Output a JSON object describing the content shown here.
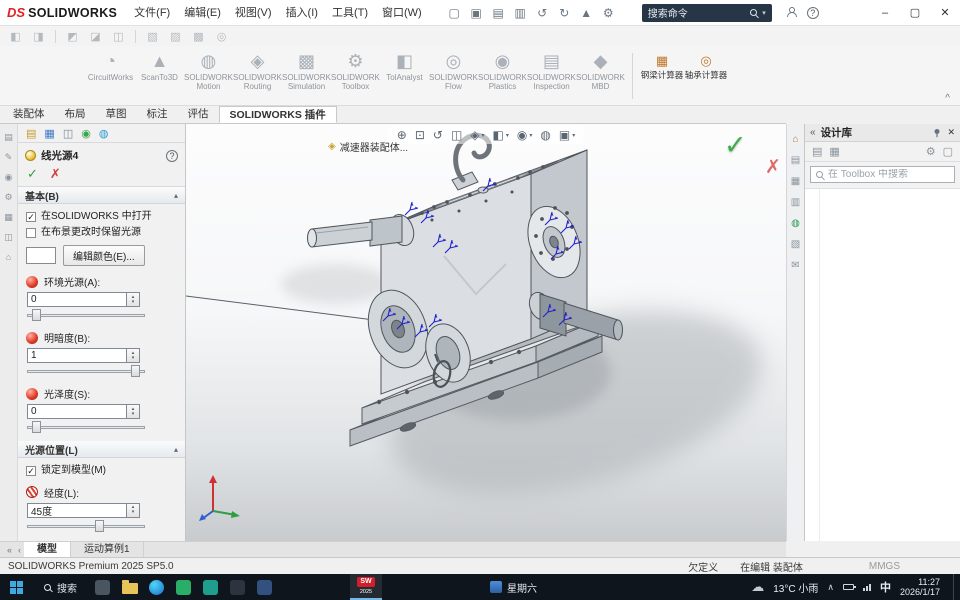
{
  "colors": {
    "logo_red": "#e12026",
    "mate_blue": "#2222cc",
    "confirm_green": "#3fae49",
    "cancel_red": "#df6a6a",
    "taskbar_bg": "#0f151d",
    "command_search_bg": "#273646",
    "taskbar_accent": "#76b9e8"
  },
  "icons": {
    "check": "✓",
    "cross": "✗",
    "help": "?",
    "caret_down": "▾",
    "collapse_up": "▴",
    "spin_up": "▴",
    "spin_down": "▾",
    "minimize": "–",
    "maximize": "▢",
    "close": "✕",
    "chevrons_left": "«",
    "tab_prev": "«",
    "tab_prev2": "‹",
    "ribbon_collapse": "^",
    "tray_expand": "∧",
    "cloud": "☁",
    "assembly": "◈",
    "titlebar": [
      "▢",
      "▣",
      "▤",
      "▥",
      "↺",
      "↻",
      "▲",
      "⚙"
    ],
    "qat": [
      "◧",
      "◨",
      "◩",
      "◪",
      "◫",
      "▧",
      "▨",
      "▩",
      "◎"
    ],
    "left_strip": [
      "▤",
      "✎",
      "◉",
      "⚙",
      "▦",
      "◫",
      "⌂"
    ],
    "pm_tabs": [
      "▤",
      "▦",
      "◫",
      "◉",
      "◍"
    ],
    "headsup": [
      "⊕",
      "⊡",
      "↺",
      "◫",
      "◈",
      "◧",
      "◉",
      "◍",
      "▣"
    ],
    "right_strip": [
      "⌂",
      "▤",
      "▦",
      "▥",
      "◍",
      "▧",
      "✉"
    ],
    "taskpane_toolbar": [
      "▤",
      "▦",
      "⚙",
      "▢"
    ],
    "addins": [
      "◔",
      "▲",
      "◍",
      "◈",
      "▩",
      "⚙",
      "◧",
      "◎",
      "◉",
      "▤",
      "◆"
    ],
    "calculators": [
      "▦",
      "◎"
    ]
  },
  "title_bar": {
    "logo_mark": "DS",
    "logo_text": "SOLIDWORKS",
    "menus": [
      "文件(F)",
      "编辑(E)",
      "视图(V)",
      "插入(I)",
      "工具(T)",
      "窗口(W)"
    ],
    "search_placeholder": "搜索命令"
  },
  "ribbon": {
    "addins": [
      "CircuitWorks",
      "ScanTo3D",
      "SOLIDWORKS Motion",
      "SOLIDWORKS Routing",
      "SOLIDWORKS Simulation",
      "SOLIDWORKS Toolbox",
      "TolAnalyst",
      "SOLIDWORKS Flow Simulation",
      "SOLIDWORKS Plastics",
      "SOLIDWORKS Inspection",
      "SOLIDWORKS MBD"
    ],
    "calculators": [
      "钢梁计算器",
      "轴承计算器"
    ]
  },
  "command_tabs": [
    "装配体",
    "布局",
    "草图",
    "标注",
    "评估",
    "SOLIDWORKS 插件"
  ],
  "property_manager": {
    "title": "线光源4",
    "basic_section": "基本(B)",
    "open_in_solidworks": "在SOLIDWORKS 中打开",
    "keep_light_on_scene_change": "在布景更改时保留光源",
    "edit_color_button": "编辑颜色(E)...",
    "ambient_label": "环境光源(A):",
    "ambient_value": "0",
    "brightness_label": "明暗度(B):",
    "brightness_value": "1",
    "specular_label": "光泽度(S):",
    "specular_value": "0",
    "position_section": "光源位置(L)",
    "lock_to_model": "锁定到模型(M)",
    "longitude_label": "经度(L):",
    "longitude_value": "45度"
  },
  "viewport": {
    "document_tab": "减速器装配体..."
  },
  "task_pane": {
    "title": "设计库",
    "search_placeholder": "在 Toolbox 中搜索"
  },
  "doc_tabs": [
    "模型",
    "运动算例1"
  ],
  "status_bar": {
    "product": "SOLIDWORKS Premium 2025 SP5.0",
    "state": "欠定义",
    "editing": "在编辑 装配体",
    "units": "MMGS"
  },
  "taskbar": {
    "search_label": "搜索",
    "sw_label": "SW",
    "sw_year": "2025",
    "day": "星期六",
    "weather": "13°C 小雨",
    "ime": "中",
    "time": "11:27",
    "date": "2026/1/17"
  }
}
